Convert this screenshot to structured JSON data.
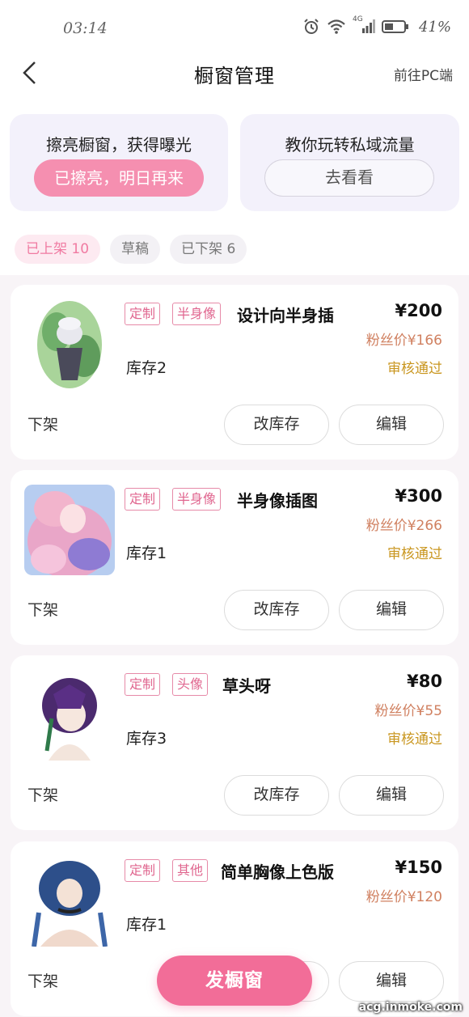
{
  "status": {
    "time": "03:14",
    "network": "4G",
    "battery": "41%"
  },
  "nav": {
    "title": "橱窗管理",
    "pc_link": "前往PC端"
  },
  "promo": {
    "left_title": "擦亮橱窗，获得曝光",
    "left_button": "已擦亮，明日再来",
    "right_title": "教你玩转私域流量",
    "right_button": "去看看"
  },
  "tabs": [
    {
      "label": "已上架 10",
      "active": true
    },
    {
      "label": "草稿",
      "active": false
    },
    {
      "label": "已下架 6",
      "active": false
    }
  ],
  "items": [
    {
      "tags": [
        "定制",
        "半身像"
      ],
      "title": "设计向半身插",
      "price": "¥200",
      "fan_price": "粉丝价¥166",
      "status": "审核通过",
      "stock": "库存2",
      "delist": "下架",
      "stock_btn": "改库存",
      "edit_btn": "编辑"
    },
    {
      "tags": [
        "定制",
        "半身像"
      ],
      "title": "半身像插图",
      "price": "¥300",
      "fan_price": "粉丝价¥266",
      "status": "审核通过",
      "stock": "库存1",
      "delist": "下架",
      "stock_btn": "改库存",
      "edit_btn": "编辑"
    },
    {
      "tags": [
        "定制",
        "头像"
      ],
      "title": "草头呀",
      "price": "¥80",
      "fan_price": "粉丝价¥55",
      "status": "审核通过",
      "stock": "库存3",
      "delist": "下架",
      "stock_btn": "改库存",
      "edit_btn": "编辑"
    },
    {
      "tags": [
        "定制",
        "其他"
      ],
      "title": "简单胸像上色版",
      "price": "¥150",
      "fan_price": "粉丝价¥120",
      "status": "",
      "stock": "库存1",
      "delist": "下架",
      "stock_btn": "改库存",
      "edit_btn": "编辑"
    }
  ],
  "fab": {
    "label": "发橱窗"
  },
  "watermark": "acg.inmoke.com",
  "colors": {
    "accent": "#f26d98",
    "tag": "#e0668f",
    "fan_price": "#d08060",
    "review": "#c9961f"
  }
}
